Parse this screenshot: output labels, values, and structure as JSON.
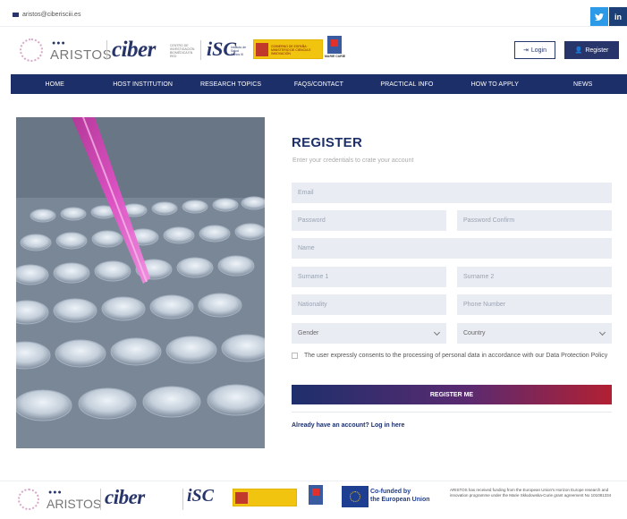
{
  "topbar": {
    "email": "aristos@ciberisciii.es",
    "twitter_icon": "twitter-icon",
    "linkedin_icon": "linkedin-icon"
  },
  "header": {
    "aristos_logo": "ARISTOS",
    "ciber_logo": "ciber",
    "ciber_sub": "CENTRO DE INVESTIGACIÓN BIOMÉDICA EN RED",
    "isc_logo": "iSC",
    "isc_sub": "Instituto de Salud Carlos III",
    "ministry_logo": "GOBIERNO DE ESPAÑA · MINISTERIO DE CIENCIA E INNOVACIÓN",
    "marie_curie_logo": "MARIE CURIE",
    "login_label": "Login",
    "register_label": "Register"
  },
  "nav": {
    "items": [
      "HOME",
      "HOST INSTITUTION",
      "RESEARCH TOPICS",
      "FAQS/CONTACT",
      "PRACTICAL INFO",
      "HOW TO APPLY",
      "NEWS"
    ]
  },
  "form": {
    "title": "REGISTER",
    "subtitle": "Enter your credentials to crate your account",
    "email_placeholder": "Email",
    "password_placeholder": "Password",
    "password_confirm_placeholder": "Password Confirm",
    "name_placeholder": "Name",
    "surname1_placeholder": "Surname 1",
    "surname2_placeholder": "Surname 2",
    "nationality_placeholder": "Nationality",
    "phone_placeholder": "Phone Number",
    "gender_selected": "Gender",
    "country_selected": "Country",
    "consent_text": "The user expressly consents to the processing of personal data in accordance with our Data Protection Policy",
    "submit_label": "REGISTER ME",
    "login_link": "Already have an account? Log in here"
  },
  "footer": {
    "aristos_logo": "ARISTOS",
    "ciber_logo": "ciber",
    "cofunded_line1": "Co-funded by",
    "cofunded_line2": "the European Union",
    "eu_note": "ARISTOS has received funding from the European Union's Horizon Europe research and innovation programme under the Marie Skłodowska-Curie grant agreement No 101081334"
  },
  "colors": {
    "navy": "#1c2f68",
    "accent_red": "#b22033",
    "twitter": "#2d9ae8",
    "pipette_pink": "#d63fb3"
  }
}
